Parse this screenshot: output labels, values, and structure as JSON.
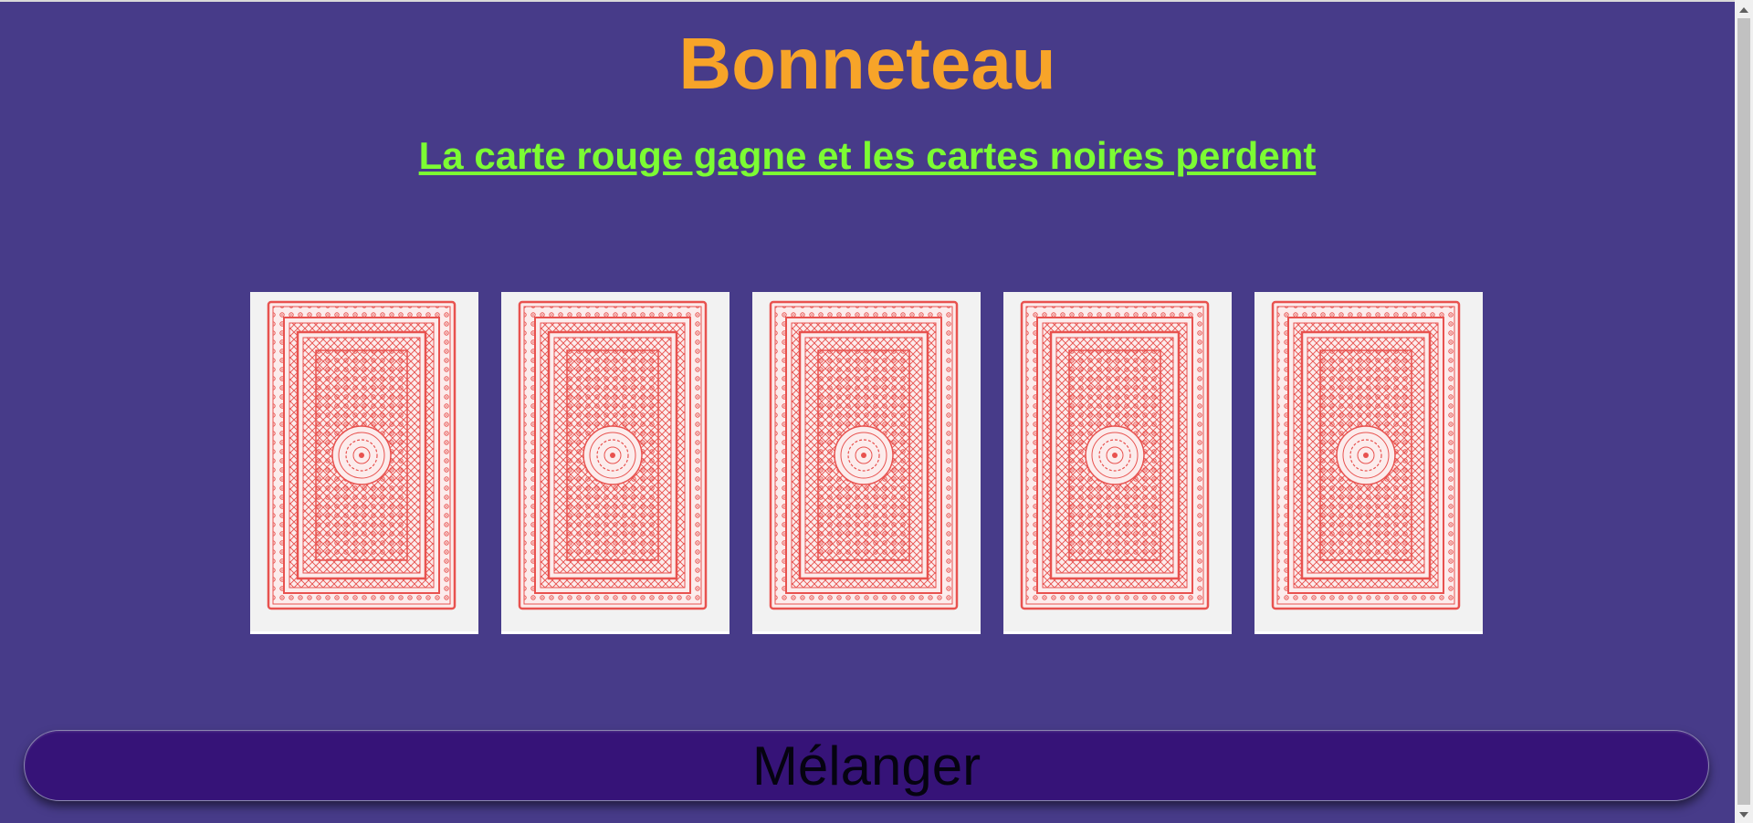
{
  "page": {
    "title": "Bonneteau",
    "subtitle": "La carte rouge gagne et les cartes noires perdent"
  },
  "cards": [
    {
      "face": "back"
    },
    {
      "face": "back"
    },
    {
      "face": "back"
    },
    {
      "face": "back"
    },
    {
      "face": "back"
    }
  ],
  "controls": {
    "shuffle_label": "Mélanger"
  },
  "colors": {
    "background": "#473b89",
    "title": "#f7a429",
    "subtitle": "#7cfc33",
    "button": "#361378",
    "card_pattern": "#e8524f"
  }
}
